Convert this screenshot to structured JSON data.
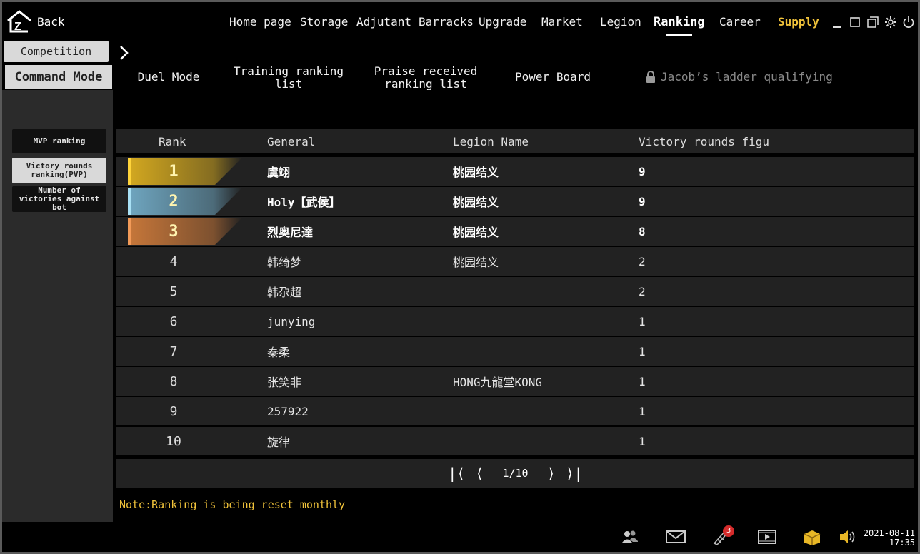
{
  "back_label": "Back",
  "nav": {
    "items": [
      "Home page",
      "Storage",
      "Adjutant",
      "Barracks",
      "Upgrade",
      "Market",
      "Legion",
      "Ranking",
      "Career",
      "Supply"
    ],
    "active": "Ranking"
  },
  "competition_tab": "Competition",
  "modes": {
    "command": "Command Mode",
    "duel": "Duel Mode",
    "training": "Training ranking list",
    "praise": "Praise received ranking list",
    "power": "Power Board",
    "ladder": "Jacob’s ladder qualifying"
  },
  "sidebar": {
    "mvp": "MVP ranking",
    "victory_pvp": "Victory rounds ranking(PVP)",
    "victories_bot": "Number of victories against bot"
  },
  "table": {
    "headers": [
      "Rank",
      "General",
      "Legion Name",
      "Victory rounds figu"
    ],
    "rows": [
      {
        "rank": "1",
        "general": "虞翊",
        "legion": "桃园结义",
        "victories": "9"
      },
      {
        "rank": "2",
        "general": "Holy【武侯】",
        "legion": "桃园结义",
        "victories": "9"
      },
      {
        "rank": "3",
        "general": "烈奥尼達",
        "legion": "桃园结义",
        "victories": "8"
      },
      {
        "rank": "4",
        "general": "韩绮梦",
        "legion": "桃园结义",
        "victories": "2"
      },
      {
        "rank": "5",
        "general": "韩尕超",
        "legion": "",
        "victories": "2"
      },
      {
        "rank": "6",
        "general": "junying",
        "legion": "",
        "victories": "1"
      },
      {
        "rank": "7",
        "general": "秦柔",
        "legion": "",
        "victories": "1"
      },
      {
        "rank": "8",
        "general": "张笑非",
        "legion": "HONG九龍堂KONG",
        "victories": "1"
      },
      {
        "rank": "9",
        "general": "257922",
        "legion": "",
        "victories": "1"
      },
      {
        "rank": "10",
        "general": "旋律",
        "legion": "",
        "victories": "1"
      }
    ]
  },
  "pager": {
    "page": "1/10"
  },
  "note": "Note:Ranking is being reset monthly",
  "bottom": {
    "badge_count": "3",
    "date": "2021-08-11",
    "time": "17:35"
  },
  "colors": {
    "accent": "#f0c23a",
    "gold": "#d4a920",
    "silver": "#6fa6c0",
    "bronze": "#c7773a"
  }
}
